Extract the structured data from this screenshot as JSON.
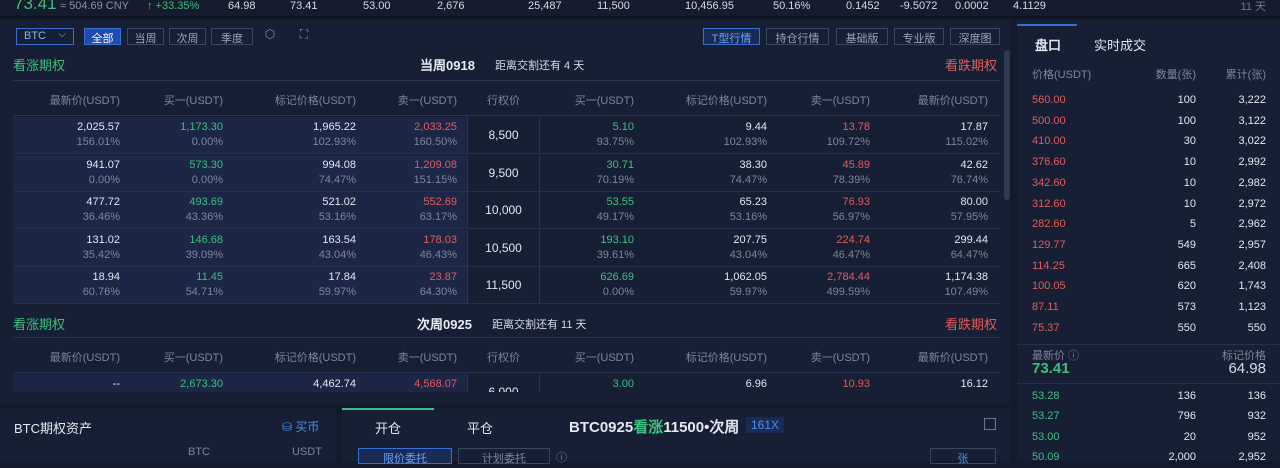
{
  "ticker": {
    "last_price": "73.41",
    "cny": "≈ 504.69 CNY",
    "change": "↑ +33.35%",
    "values": [
      "64.98",
      "73.41",
      "53.00",
      "2,676",
      "25,487",
      "11,500",
      "10,456.95",
      "50.16%",
      "0.1452",
      "-9.5072",
      "0.0002",
      "4.1129"
    ],
    "right_label": "11 天"
  },
  "toolbar": {
    "underlying": "BTC",
    "filters": [
      "全部",
      "当周",
      "次周",
      "季度"
    ],
    "views": [
      "T型行情",
      "持仓行情",
      "基础版",
      "专业版",
      "深度图"
    ]
  },
  "sections": [
    {
      "call_label": "看涨期权",
      "put_label": "看跌期权",
      "week": "当周0918",
      "delivery": "距离交割还有  4 天"
    },
    {
      "call_label": "看涨期权",
      "put_label": "看跌期权",
      "week": "次周0925",
      "delivery": "距离交割还有  11 天"
    }
  ],
  "columns": {
    "call": [
      "最新价(USDT)",
      "买一(USDT)",
      "标记价格(USDT)",
      "卖一(USDT)"
    ],
    "strike": "行权价",
    "put": [
      "买一(USDT)",
      "标记价格(USDT)",
      "卖一(USDT)",
      "最新价(USDT)"
    ]
  },
  "rows1": [
    {
      "c": [
        "2,025.57",
        "1,173.30",
        "1,965.22",
        "2,033.25"
      ],
      "cp": [
        "156.01%",
        "0.00%",
        "102.93%",
        "160.50%"
      ],
      "k": "8,500",
      "p": [
        "5.10",
        "9.44",
        "13.78",
        "17.87"
      ],
      "pp": [
        "93.75%",
        "102.93%",
        "109.72%",
        "115.02%"
      ]
    },
    {
      "c": [
        "941.07",
        "573.30",
        "994.08",
        "1,209.08"
      ],
      "cp": [
        "0.00%",
        "0.00%",
        "74.47%",
        "151.15%"
      ],
      "k": "9,500",
      "p": [
        "30.71",
        "38.30",
        "45.89",
        "42.62"
      ],
      "pp": [
        "70.19%",
        "74.47%",
        "78.39%",
        "76.74%"
      ]
    },
    {
      "c": [
        "477.72",
        "493.69",
        "521.02",
        "552.69"
      ],
      "cp": [
        "36.46%",
        "43.36%",
        "53.16%",
        "63.17%"
      ],
      "k": "10,000",
      "p": [
        "53.55",
        "65.23",
        "76.93",
        "80.00"
      ],
      "pp": [
        "49.17%",
        "53.16%",
        "56.97%",
        "57.95%"
      ]
    },
    {
      "c": [
        "131.02",
        "146.68",
        "163.54",
        "178.03"
      ],
      "cp": [
        "35.42%",
        "39.09%",
        "43.04%",
        "46.43%"
      ],
      "k": "10,500",
      "p": [
        "193.10",
        "207.75",
        "224.74",
        "299.44"
      ],
      "pp": [
        "39.61%",
        "43.04%",
        "46.47%",
        "64.47%"
      ]
    },
    {
      "c": [
        "18.94",
        "11.45",
        "17.84",
        "23.87"
      ],
      "cp": [
        "60.76%",
        "54.71%",
        "59.97%",
        "64.30%"
      ],
      "k": "11,500",
      "p": [
        "626.69",
        "1,062.05",
        "2,784.44",
        "1,174.38"
      ],
      "pp": [
        "0.00%",
        "59.97%",
        "499.59%",
        "107.49%"
      ]
    }
  ],
  "rows2": [
    {
      "c": [
        "--",
        "2,673.30",
        "4,462.74",
        "4,568.07"
      ],
      "k": "6,000",
      "p": [
        "3.00",
        "6.96",
        "10.93",
        "16.12"
      ]
    }
  ],
  "assets": {
    "title": "BTC期权资产",
    "buy": "买币",
    "col1": "BTC",
    "col2": "USDT"
  },
  "trade": {
    "tab_open": "开仓",
    "tab_close": "平仓",
    "instrument_a": "BTC0925",
    "instrument_b": "看涨",
    "instrument_c": "11500•次周",
    "leverage": "161X",
    "order_limit": "限价委托",
    "order_plan": "计划委托",
    "unit": "张"
  },
  "book": {
    "tab_book": "盘口",
    "tab_trades": "实时成交",
    "headers": [
      "价格(USDT)",
      "数量(张)",
      "累计(张)"
    ],
    "asks": [
      [
        "560.00",
        "100",
        "3,222"
      ],
      [
        "500.00",
        "100",
        "3,122"
      ],
      [
        "410.00",
        "30",
        "3,022"
      ],
      [
        "376.60",
        "10",
        "2,992"
      ],
      [
        "342.60",
        "10",
        "2,982"
      ],
      [
        "312.60",
        "10",
        "2,972"
      ],
      [
        "282.60",
        "5",
        "2,962"
      ],
      [
        "129.77",
        "549",
        "2,957"
      ],
      [
        "114.25",
        "665",
        "2,408"
      ],
      [
        "100.05",
        "620",
        "1,743"
      ],
      [
        "87.11",
        "573",
        "1,123"
      ],
      [
        "75.37",
        "550",
        "550"
      ]
    ],
    "last_label": "最新价 ⓘ",
    "last_price": "73.41",
    "mark_label": "标记价格",
    "mark_price": "64.98",
    "bids": [
      [
        "53.28",
        "136",
        "136"
      ],
      [
        "53.27",
        "796",
        "932"
      ],
      [
        "53.00",
        "20",
        "952"
      ],
      [
        "50.09",
        "2,000",
        "2,952"
      ]
    ]
  }
}
